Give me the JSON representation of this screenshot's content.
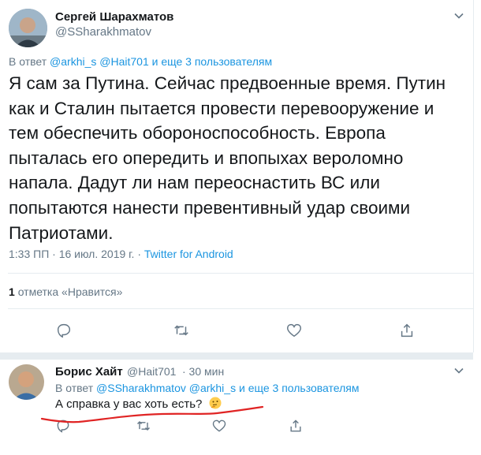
{
  "main_tweet": {
    "author_name": "Сергей Шарахматов",
    "author_handle": "@SSharakhmatov",
    "reply_prefix": "В ответ",
    "reply_handles": "@arkhi_s @Hait701",
    "reply_more": "и еще 3 пользователям",
    "text": "Я сам за Путина. Сейчас предвоенные время. Путин как и Сталин пытается провести перевооружение и тем обеспечить обороноспособность. Европа пыталась его опередить и впопыхах вероломно напала. Дадут ли нам переоснастить ВС или попытаются нанести превентивный удар своими Патриотами.",
    "timestamp": "1:33 ПП · 16 июл. 2019 г. · ",
    "source": "Twitter for Android",
    "likes_count": "1",
    "likes_label": "отметка «Нравится»",
    "icons": [
      "chevron-down-icon",
      "reply-icon",
      "retweet-icon",
      "like-icon",
      "share-icon"
    ]
  },
  "reply_tweet": {
    "author_name": "Борис Хайт",
    "author_handle": "@Hait701",
    "time": "· 30 мин",
    "reply_prefix": "В ответ",
    "reply_handles": "@SSharakhmatov @arkhi_s",
    "reply_more": "и еще 3 пользователям",
    "text": "А справка у вас хоть есть?",
    "emoji": "thinking-face-icon",
    "icons": [
      "chevron-down-icon",
      "reply-icon",
      "retweet-icon",
      "like-icon",
      "share-icon"
    ]
  },
  "colors": {
    "link": "#1b95e0",
    "secondary": "#657786",
    "text": "#14171a",
    "divider": "#e6ecf0",
    "underline": "#e02424"
  }
}
